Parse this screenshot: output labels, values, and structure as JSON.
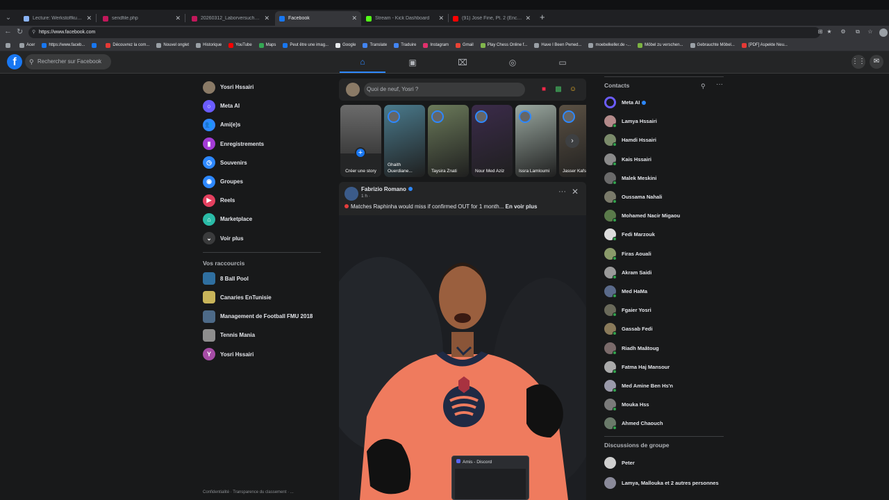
{
  "browser": {
    "tabs": [
      {
        "title": "Lecture: Werkstoffkunde (AE) - Fi...",
        "color": "#8ab4f8",
        "active": false
      },
      {
        "title": "sendfile.php",
        "color": "#c2185b",
        "active": false
      },
      {
        "title": "20260312_Laborversuche_WK_AE.p...",
        "color": "#c2185b",
        "active": false
      },
      {
        "title": "Facebook",
        "color": "#1877f2",
        "active": true
      },
      {
        "title": "Stream - Kick Dashboard",
        "color": "#53fc18",
        "active": false
      },
      {
        "title": "(91) José Fine, Pt. 2 (Enchaîne...",
        "color": "#ff0000",
        "active": false
      }
    ],
    "url": "https://www.facebook.com",
    "bookmarks": [
      {
        "label": "Acer",
        "color": "#9aa0a6"
      },
      {
        "label": "https://www.faceb...",
        "color": "#1877f2"
      },
      {
        "label": "",
        "color": "#1877f2"
      },
      {
        "label": "Découvrez la com...",
        "color": "#e53935"
      },
      {
        "label": "Nouvel onglet",
        "color": "#9aa0a6"
      },
      {
        "label": "Historique",
        "color": "#9aa0a6"
      },
      {
        "label": "YouTube",
        "color": "#ff0000"
      },
      {
        "label": "Maps",
        "color": "#34a853"
      },
      {
        "label": "Peut être une imag...",
        "color": "#1877f2"
      },
      {
        "label": "Google",
        "color": "#e8eaed"
      },
      {
        "label": "Translate",
        "color": "#4285f4"
      },
      {
        "label": "Traduire",
        "color": "#4285f4"
      },
      {
        "label": "Instagram",
        "color": "#e1306c"
      },
      {
        "label": "Gmail",
        "color": "#ea4335"
      },
      {
        "label": "Play Chess Online f...",
        "color": "#81b64c"
      },
      {
        "label": "Have I Been Pwned...",
        "color": "#9aa0a6"
      },
      {
        "label": "moebelkeller.de -...",
        "color": "#9aa0a6"
      },
      {
        "label": "Möbel zu verschen...",
        "color": "#7cb342"
      },
      {
        "label": "Gebrauchte Möbel...",
        "color": "#9aa0a6"
      },
      {
        "label": "[PDF] Aspekte Neu...",
        "color": "#e53935"
      }
    ]
  },
  "fb": {
    "search_placeholder": "Rechercher sur Facebook",
    "left_nav": [
      {
        "label": "Yosri Hssairi",
        "icon": "avatar",
        "color": "#8a7a66"
      },
      {
        "label": "Meta AI",
        "icon": "meta-ai-icon",
        "color": "#6b5cff"
      },
      {
        "label": "Ami(e)s",
        "icon": "friends-icon",
        "color": "#2d88ff"
      },
      {
        "label": "Enregistrements",
        "icon": "bookmark-icon",
        "color": "#a33bd6"
      },
      {
        "label": "Souvenirs",
        "icon": "clock-icon",
        "color": "#2d88ff"
      },
      {
        "label": "Groupes",
        "icon": "groups-icon",
        "color": "#2d88ff"
      },
      {
        "label": "Reels",
        "icon": "reels-icon",
        "color": "#e4405f"
      },
      {
        "label": "Marketplace",
        "icon": "shop-icon",
        "color": "#2abba7"
      },
      {
        "label": "Voir plus",
        "icon": "chevron-down-icon",
        "color": "#3a3b3c"
      }
    ],
    "shortcuts_title": "Vos raccourcis",
    "shortcuts": [
      {
        "label": "8 Ball Pool",
        "color": "#2f6fa0"
      },
      {
        "label": "Canaries EnTunisie",
        "color": "#c9b55a"
      },
      {
        "label": "Management de Football FMU 2018",
        "color": "#4d6a88"
      },
      {
        "label": "Tennis Mania",
        "color": "#8e8e8e"
      },
      {
        "label": "Yosri Hssairi",
        "color": "#a64ca6"
      }
    ],
    "footer": "Confidentialité · Transparence du classement · ...",
    "composer_placeholder": "Quoi de neuf, Yosri ?",
    "stories": [
      {
        "name": "Créer une story",
        "color": "#555"
      },
      {
        "name": "Ghaith Ouerdiane...",
        "color": "#4a7a8c"
      },
      {
        "name": "Taysira Znati",
        "color": "#6b7a5a"
      },
      {
        "name": "Nour Med Aziz",
        "color": "#3b2b4a"
      },
      {
        "name": "Issra Lamloumi",
        "color": "#9aa8a0"
      },
      {
        "name": "Jasser Kafs",
        "color": "#5a5043"
      }
    ],
    "post": {
      "author": "Fabrizio Romano",
      "meta": "1 h ·",
      "text": "Matches Raphinha would miss if confirmed OUT for 1 month...",
      "see_more": "En voir plus"
    },
    "contacts_title": "Contacts",
    "contacts": [
      {
        "name": "Meta AI",
        "color": "#6b5cff",
        "online": false
      },
      {
        "name": "Lamya Hssairi",
        "color": "#b38a8a",
        "online": true
      },
      {
        "name": "Hamdi Hssairi",
        "color": "#7a8a6a",
        "online": true
      },
      {
        "name": "Kais Hssairi",
        "color": "#8a8a8a",
        "online": true
      },
      {
        "name": "Malek Meskini",
        "color": "#6a6a6a",
        "online": true
      },
      {
        "name": "Oussama Nahali",
        "color": "#7a7a6a",
        "online": true
      },
      {
        "name": "Mohamed Nacir Migaou",
        "color": "#5a7a4a",
        "online": true
      },
      {
        "name": "Fedi Marzouk",
        "color": "#dcdcdc",
        "online": true
      },
      {
        "name": "Firas Aouali",
        "color": "#8a9a6a",
        "online": true
      },
      {
        "name": "Akram Saidi",
        "color": "#9a9a9a",
        "online": true
      },
      {
        "name": "Med HaMa",
        "color": "#5a6a8a",
        "online": true
      },
      {
        "name": "Fgaier Yosri",
        "color": "#6a6a5a",
        "online": true
      },
      {
        "name": "Gassab Fedi",
        "color": "#8a7a5a",
        "online": true
      },
      {
        "name": "Riadh Maâtoug",
        "color": "#7a6a6a",
        "online": true
      },
      {
        "name": "Fatma Haj Mansour",
        "color": "#aaaaaa",
        "online": true
      },
      {
        "name": "Med Amine Ben Hs'n",
        "color": "#9a9aaa",
        "online": true
      },
      {
        "name": "Mouka Hss",
        "color": "#7a7a7a",
        "online": true
      },
      {
        "name": "Ahmed Chaouch",
        "color": "#6a7a6a",
        "online": true
      }
    ],
    "groups_title": "Discussions de groupe",
    "groups": [
      {
        "name": "Peter",
        "color": "#cfcfcf"
      },
      {
        "name": "Lamya, Mallouka et 2 autres personnes",
        "color": "#8a8a9a"
      }
    ]
  },
  "discord_popup": {
    "title": "Amis - Discord"
  }
}
